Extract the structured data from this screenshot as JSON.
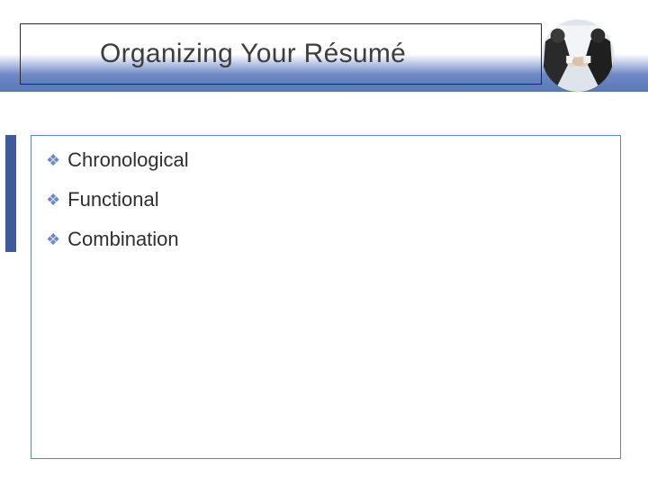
{
  "header": {
    "title": "Organizing Your Résumé"
  },
  "badge": {
    "name": "handshake-photo"
  },
  "content": {
    "bullets": [
      {
        "label": "Chronological"
      },
      {
        "label": "Functional"
      },
      {
        "label": "Combination"
      }
    ]
  },
  "colors": {
    "accent": "#6d88c4",
    "border": "#6a84bf",
    "side": "#3e5a9a"
  }
}
